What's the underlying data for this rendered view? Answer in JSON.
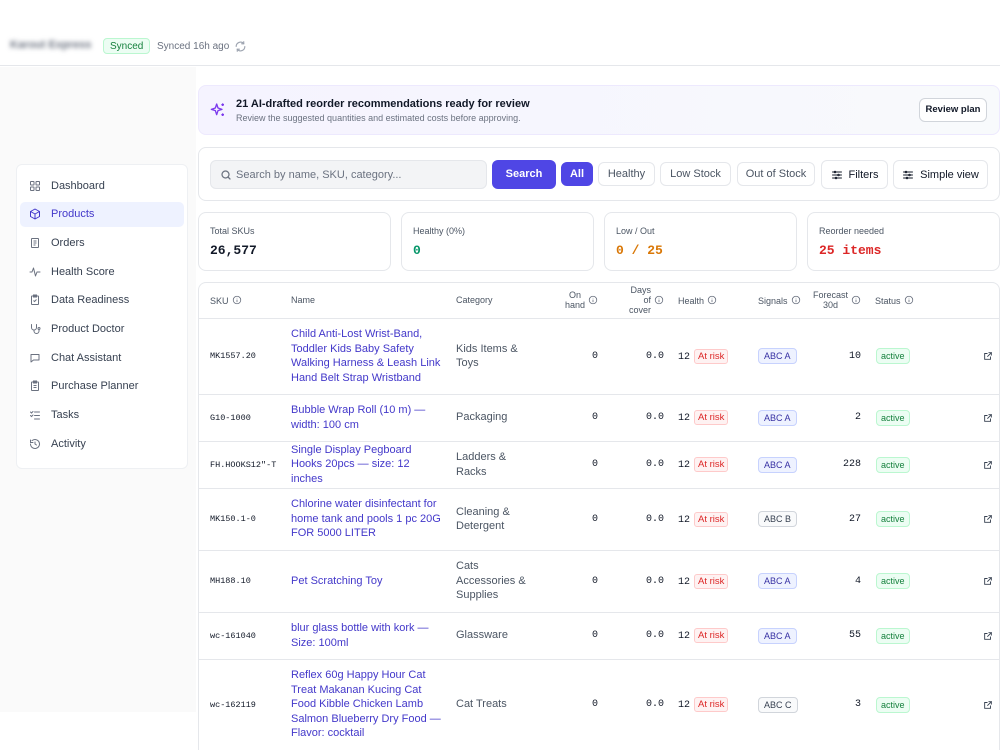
{
  "header": {
    "brand": "Karout Express",
    "sync_badge": "Synced",
    "sync_time": "Synced 16h ago"
  },
  "sidebar": {
    "items": [
      {
        "label": "Dashboard",
        "icon": "grid-icon"
      },
      {
        "label": "Products",
        "icon": "box-icon",
        "active": true
      },
      {
        "label": "Orders",
        "icon": "receipt-icon"
      },
      {
        "label": "Health Score",
        "icon": "pulse-icon"
      },
      {
        "label": "Data Readiness",
        "icon": "clipboard-check-icon"
      },
      {
        "label": "Product Doctor",
        "icon": "stethoscope-icon"
      },
      {
        "label": "Chat Assistant",
        "icon": "chat-icon"
      },
      {
        "label": "Purchase Planner",
        "icon": "clipboard-list-icon"
      },
      {
        "label": "Tasks",
        "icon": "tasks-icon"
      },
      {
        "label": "Activity",
        "icon": "history-icon"
      }
    ]
  },
  "banner": {
    "title": "21 AI-drafted reorder recommendations ready for review",
    "subtitle": "Review the suggested quantities and estimated costs before approving.",
    "button": "Review plan"
  },
  "filters": {
    "search_placeholder": "Search by name, SKU, category...",
    "search_button": "Search",
    "chips": [
      "All",
      "Healthy",
      "Low Stock",
      "Out of Stock"
    ],
    "active_chip": "All",
    "filters_button": "Filters",
    "view_button": "Simple view"
  },
  "stats": [
    {
      "label": "Total SKUs",
      "value": "26,577",
      "color": "#111827"
    },
    {
      "label": "Healthy (0%)",
      "value": "0",
      "color": "#059669"
    },
    {
      "label": "Low / Out",
      "value": "0 / 25",
      "color": "#d97706"
    },
    {
      "label": "Reorder needed",
      "value": "25 items",
      "color": "#dc2626"
    }
  ],
  "table": {
    "headers": {
      "sku": "SKU",
      "name": "Name",
      "category": "Category",
      "on_hand_1": "On",
      "on_hand_2": "hand",
      "days_1": "Days",
      "days_2": "of",
      "days_3": "cover",
      "health": "Health",
      "signals": "Signals",
      "forecast_1": "Forecast",
      "forecast_2": "30d",
      "status": "Status"
    },
    "rows": [
      {
        "sku": "MK1557.20",
        "name": "Child Anti-Lost Wrist-Band, Toddler Kids Baby Safety Walking Harness & Leash Link Hand Belt Strap Wristband",
        "category": "Kids Items & Toys",
        "on_hand": "0",
        "days": "0.0",
        "health": "12",
        "risk": "At risk",
        "signal": "ABC A",
        "forecast": "10",
        "status": "active"
      },
      {
        "sku": "G10-1000",
        "name": "Bubble Wrap Roll (10 m) — width: 100 cm",
        "category": "Packaging",
        "on_hand": "0",
        "days": "0.0",
        "health": "12",
        "risk": "At risk",
        "signal": "ABC A",
        "forecast": "2",
        "status": "active"
      },
      {
        "sku": "FH.HOOKS12\"-T",
        "name": "Single Display Pegboard Hooks 20pcs — size: 12 inches",
        "category": "Ladders & Racks",
        "on_hand": "0",
        "days": "0.0",
        "health": "12",
        "risk": "At risk",
        "signal": "ABC A",
        "forecast": "228",
        "status": "active"
      },
      {
        "sku": "MK150.1-0",
        "name": "Chlorine water disinfectant for home tank and pools 1 pc 20G FOR 5000 LITER",
        "category": "Cleaning & Detergent",
        "on_hand": "0",
        "days": "0.0",
        "health": "12",
        "risk": "At risk",
        "signal": "ABC B",
        "forecast": "27",
        "status": "active"
      },
      {
        "sku": "MH188.10",
        "name": "Pet Scratching Toy",
        "category": "Cats Accessories & Supplies",
        "on_hand": "0",
        "days": "0.0",
        "health": "12",
        "risk": "At risk",
        "signal": "ABC A",
        "forecast": "4",
        "status": "active"
      },
      {
        "sku": "wc-161040",
        "name": "blur glass bottle with kork — Size: 100ml",
        "category": "Glassware",
        "on_hand": "0",
        "days": "0.0",
        "health": "12",
        "risk": "At risk",
        "signal": "ABC A",
        "forecast": "55",
        "status": "active"
      },
      {
        "sku": "wc-162119",
        "name": "Reflex 60g Happy Hour Cat Treat Makanan Kucing Cat Food Kibble Chicken Lamb Salmon Blueberry Dry Food — Flavor: cocktail",
        "category": "Cat Treats",
        "on_hand": "0",
        "days": "0.0",
        "health": "12",
        "risk": "At risk",
        "signal": "ABC C",
        "forecast": "3",
        "status": "active"
      }
    ]
  }
}
